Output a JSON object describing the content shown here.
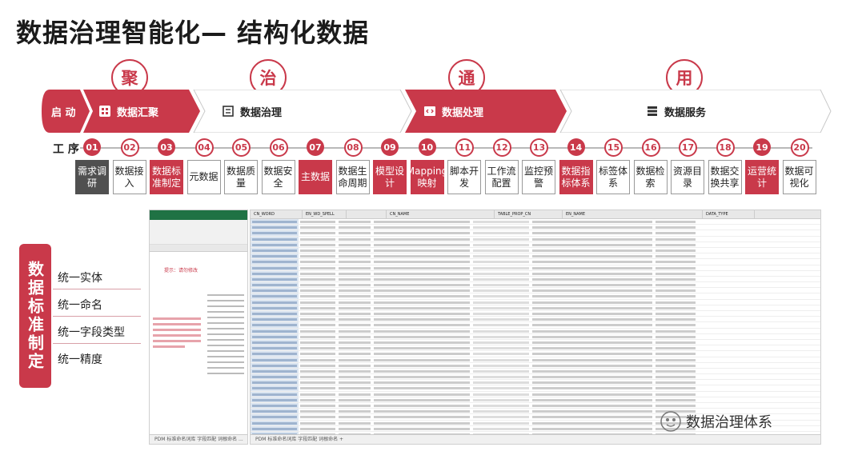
{
  "title": "数据治理智能化— 结构化数据",
  "stages": [
    {
      "char": "聚"
    },
    {
      "char": "治"
    },
    {
      "char": "通"
    },
    {
      "char": "用"
    }
  ],
  "band": {
    "start": "启 动",
    "segments": [
      {
        "label": "数据汇聚",
        "icon": "grid-icon"
      },
      {
        "label": "数据治理",
        "icon": "list-icon"
      },
      {
        "label": "数据处理",
        "icon": "code-icon"
      },
      {
        "label": "数据服务",
        "icon": "server-icon"
      }
    ]
  },
  "process_label": "工 序",
  "steps": [
    {
      "num": "01",
      "label": "需求调研",
      "style": "dark"
    },
    {
      "num": "02",
      "label": "数据接入",
      "style": "plain"
    },
    {
      "num": "03",
      "label": "数据标准制定",
      "style": "red"
    },
    {
      "num": "04",
      "label": "元数据",
      "style": "plain"
    },
    {
      "num": "05",
      "label": "数据质量",
      "style": "plain"
    },
    {
      "num": "06",
      "label": "数据安全",
      "style": "plain"
    },
    {
      "num": "07",
      "label": "主数据",
      "style": "red"
    },
    {
      "num": "08",
      "label": "数据生命周期",
      "style": "plain"
    },
    {
      "num": "09",
      "label": "模型设计",
      "style": "red"
    },
    {
      "num": "10",
      "label": "Mapping映射",
      "style": "red"
    },
    {
      "num": "11",
      "label": "脚本开发",
      "style": "plain"
    },
    {
      "num": "12",
      "label": "工作流配置",
      "style": "plain"
    },
    {
      "num": "13",
      "label": "监控预警",
      "style": "plain"
    },
    {
      "num": "14",
      "label": "数据指标体系",
      "style": "red"
    },
    {
      "num": "15",
      "label": "标签体系",
      "style": "plain"
    },
    {
      "num": "16",
      "label": "数据检索",
      "style": "plain"
    },
    {
      "num": "17",
      "label": "资源目录",
      "style": "plain"
    },
    {
      "num": "18",
      "label": "数据交换共享",
      "style": "plain"
    },
    {
      "num": "19",
      "label": "运营统计",
      "style": "red"
    },
    {
      "num": "20",
      "label": "数据可视化",
      "style": "plain"
    }
  ],
  "side_label": "数据标准制定",
  "bullets": [
    "统一实体",
    "统一命名",
    "统一字段类型",
    "统一精度"
  ],
  "sheet_small": {
    "tabs": "PDM   标准命名词库   字段匹配   词根命名   ...",
    "note": "提示：请勿修改"
  },
  "sheet_big": {
    "headers": [
      "CN_WORD",
      "EN_WD_SPELL",
      "",
      "CN_NAME",
      "TABLE_PROP_CN",
      "EN_NAME",
      "DATA_TYPE"
    ],
    "tabs": "PDM   标准命名词库   字段匹配   词根命名   +"
  },
  "watermark": "数据治理体系"
}
